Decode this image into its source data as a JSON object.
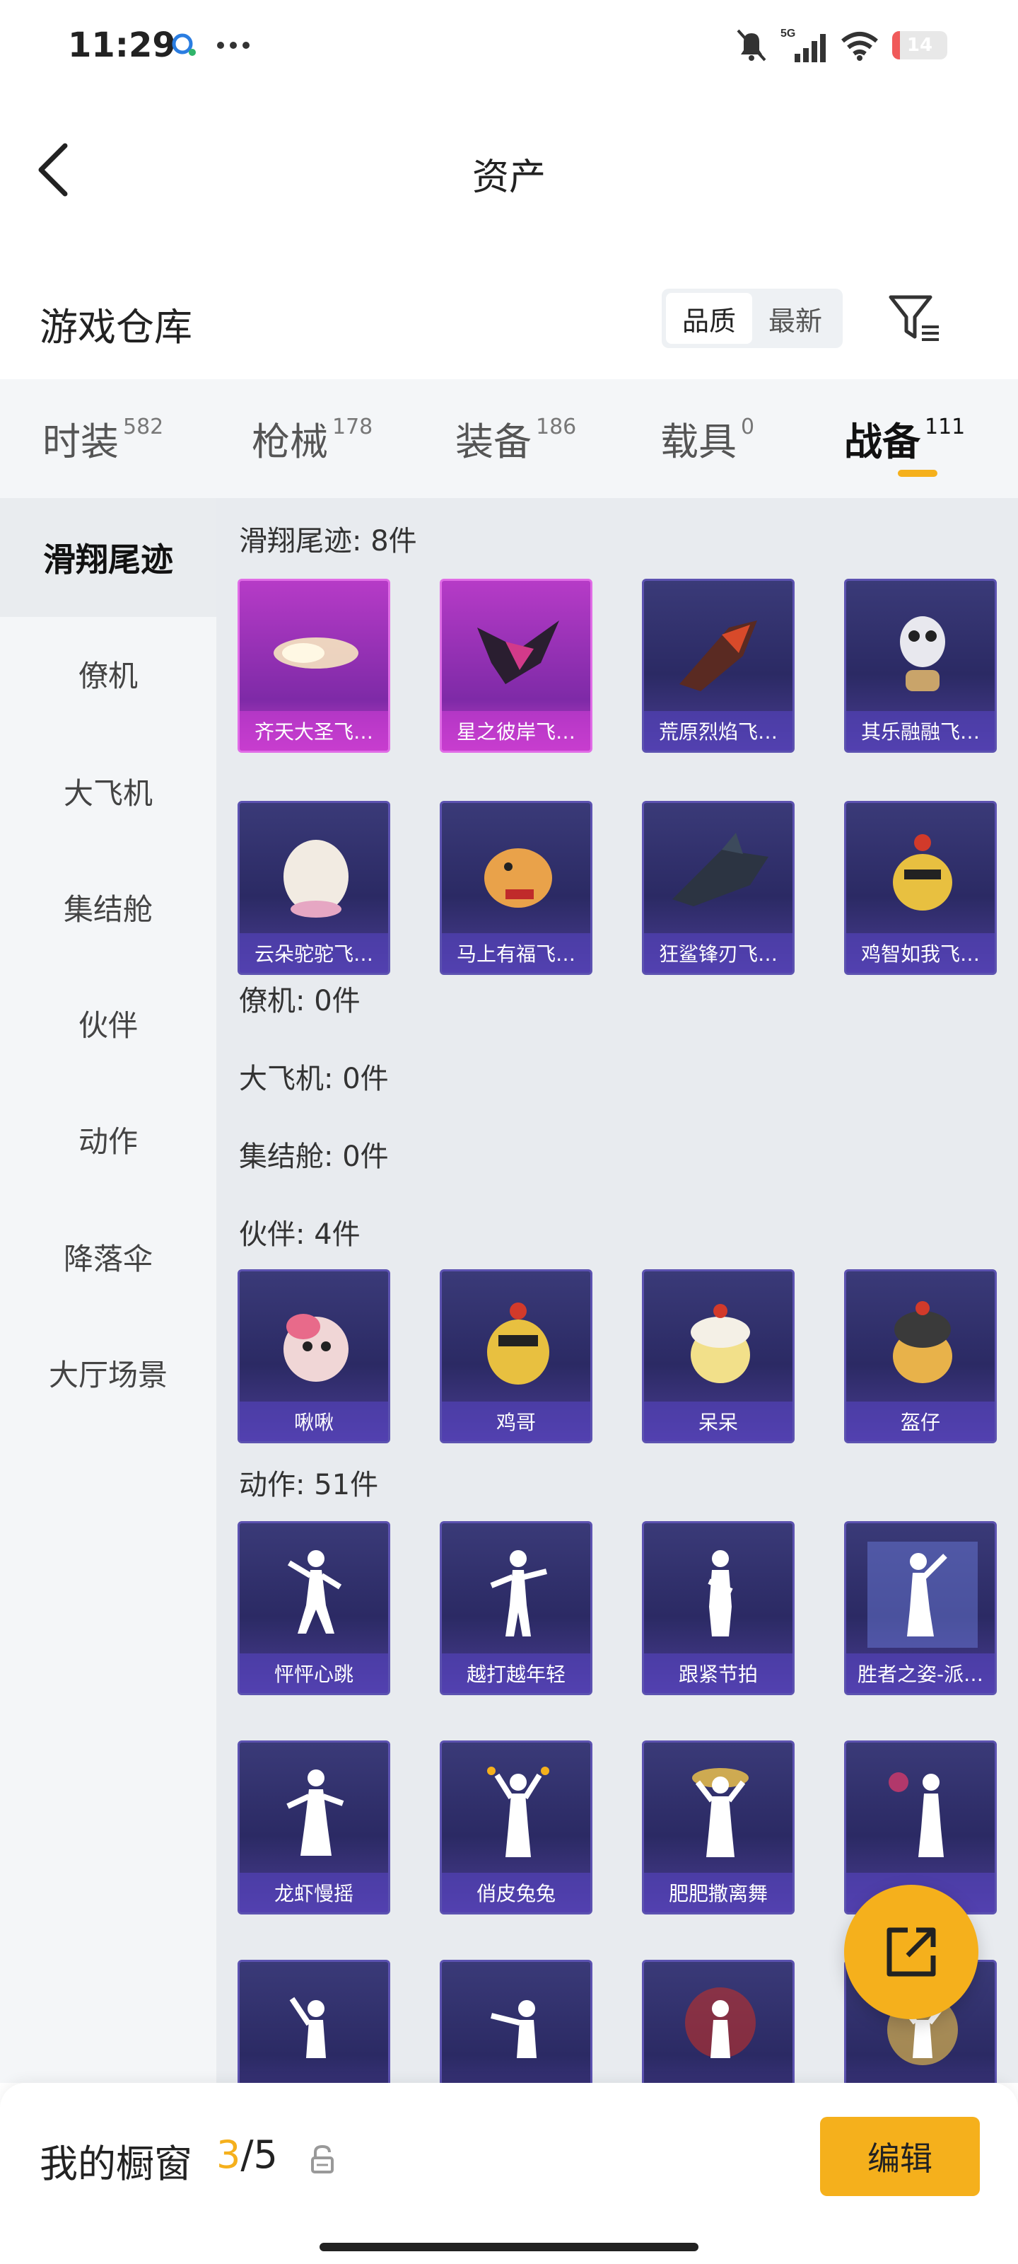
{
  "status": {
    "time": "11:29",
    "network": "5G",
    "battery": "14",
    "battery_level": 0.14
  },
  "nav": {
    "title": "资产"
  },
  "warehouse": {
    "title": "游戏仓库",
    "sort_options": [
      "品质",
      "最新"
    ]
  },
  "tabs": [
    {
      "label": "时装",
      "count": "582"
    },
    {
      "label": "枪械",
      "count": "178"
    },
    {
      "label": "装备",
      "count": "186"
    },
    {
      "label": "载具",
      "count": "0"
    },
    {
      "label": "战备",
      "count": "111"
    }
  ],
  "sidebar": [
    {
      "label": "滑翔尾迹"
    },
    {
      "label": "僚机"
    },
    {
      "label": "大飞机"
    },
    {
      "label": "集结舱"
    },
    {
      "label": "伙伴"
    },
    {
      "label": "动作"
    },
    {
      "label": "降落伞"
    },
    {
      "label": "大厅场景"
    }
  ],
  "sections": {
    "glide": {
      "title": "滑翔尾迹: 8件",
      "items": [
        "齐天大圣飞…",
        "星之彼岸飞…",
        "荒原烈焰飞…",
        "其乐融融飞…",
        "云朵驼驼飞…",
        "马上有福飞…",
        "狂鲨锋刃飞…",
        "鸡智如我飞…"
      ]
    },
    "wingman": {
      "title": "僚机: 0件"
    },
    "plane": {
      "title": "大飞机: 0件"
    },
    "pod": {
      "title": "集结舱: 0件"
    },
    "partner": {
      "title": "伙伴: 4件",
      "items": [
        "啾啾",
        "鸡哥",
        "呆呆",
        "盔仔"
      ]
    },
    "emote": {
      "title": "动作: 51件",
      "items": [
        "怦怦心跳",
        "越打越年轻",
        "跟紧节拍",
        "胜者之姿-派…",
        "龙虾慢摇",
        "俏皮兔兔",
        "肥肥撒离舞",
        ""
      ]
    }
  },
  "bottom": {
    "title": "我的橱窗",
    "count_current": "3",
    "count_total": "/5",
    "edit_label": "编辑"
  }
}
